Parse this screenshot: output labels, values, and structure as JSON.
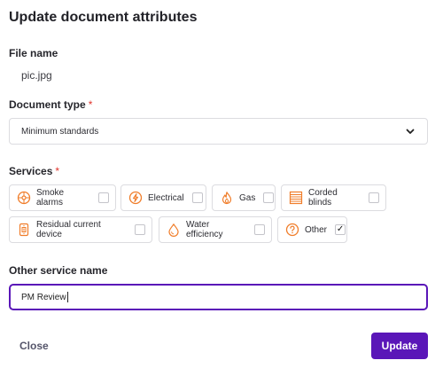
{
  "dialog": {
    "title": "Update document attributes"
  },
  "file": {
    "label": "File name",
    "value": "pic.jpg"
  },
  "document_type": {
    "label": "Document type",
    "required_mark": "*",
    "selected": "Minimum standards"
  },
  "services": {
    "label": "Services",
    "required_mark": "*",
    "items": [
      {
        "label": "Smoke alarms",
        "icon": "smoke-alarm-icon",
        "checked": false
      },
      {
        "label": "Electrical",
        "icon": "lightning-icon",
        "checked": false
      },
      {
        "label": "Gas",
        "icon": "flame-icon",
        "checked": false
      },
      {
        "label": "Corded blinds",
        "icon": "blinds-icon",
        "checked": false
      },
      {
        "label": "Residual current device",
        "icon": "rcd-icon",
        "checked": false
      },
      {
        "label": "Water efficiency",
        "icon": "water-drop-icon",
        "checked": false
      },
      {
        "label": "Other",
        "icon": "question-icon",
        "checked": true,
        "check_mark": "✓"
      }
    ]
  },
  "other_service": {
    "label": "Other service name",
    "value": "PM Review"
  },
  "actions": {
    "close_label": "Close",
    "update_label": "Update"
  },
  "colors": {
    "accent": "#5a16b8",
    "icon": "#f07d2a",
    "required": "#e0342c"
  }
}
